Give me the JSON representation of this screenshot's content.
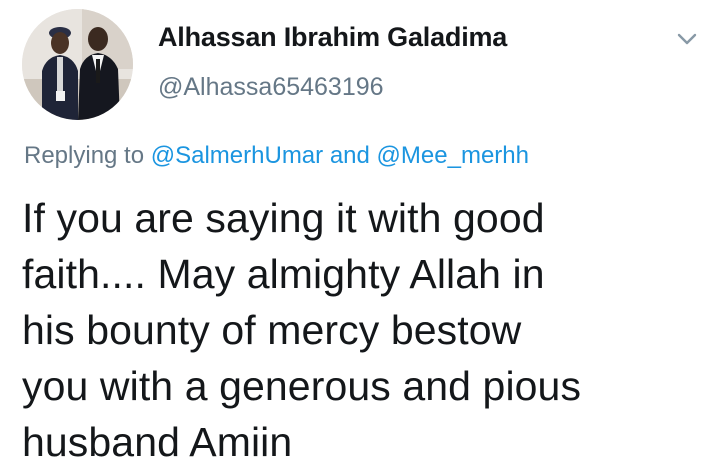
{
  "author": {
    "display_name": "Alhassan Ibrahim Galadima",
    "handle": "@Alhassa65463196",
    "avatar_icon": "profile-photo"
  },
  "menu": {
    "icon": "chevron-down-icon"
  },
  "reply": {
    "prefix": "Replying to",
    "mention_1": "@SalmerhUmar",
    "conjunction": "and",
    "mention_2": "@Mee_merhh"
  },
  "tweet": {
    "lines": [
      "If you are saying it with good",
      "faith.... May almighty Allah in",
      "his bounty of mercy bestow",
      "you with a generous and pious",
      "husband Amiin"
    ]
  },
  "colors": {
    "text_primary": "#14171a",
    "text_secondary": "#657786",
    "link": "#1b95e0"
  }
}
